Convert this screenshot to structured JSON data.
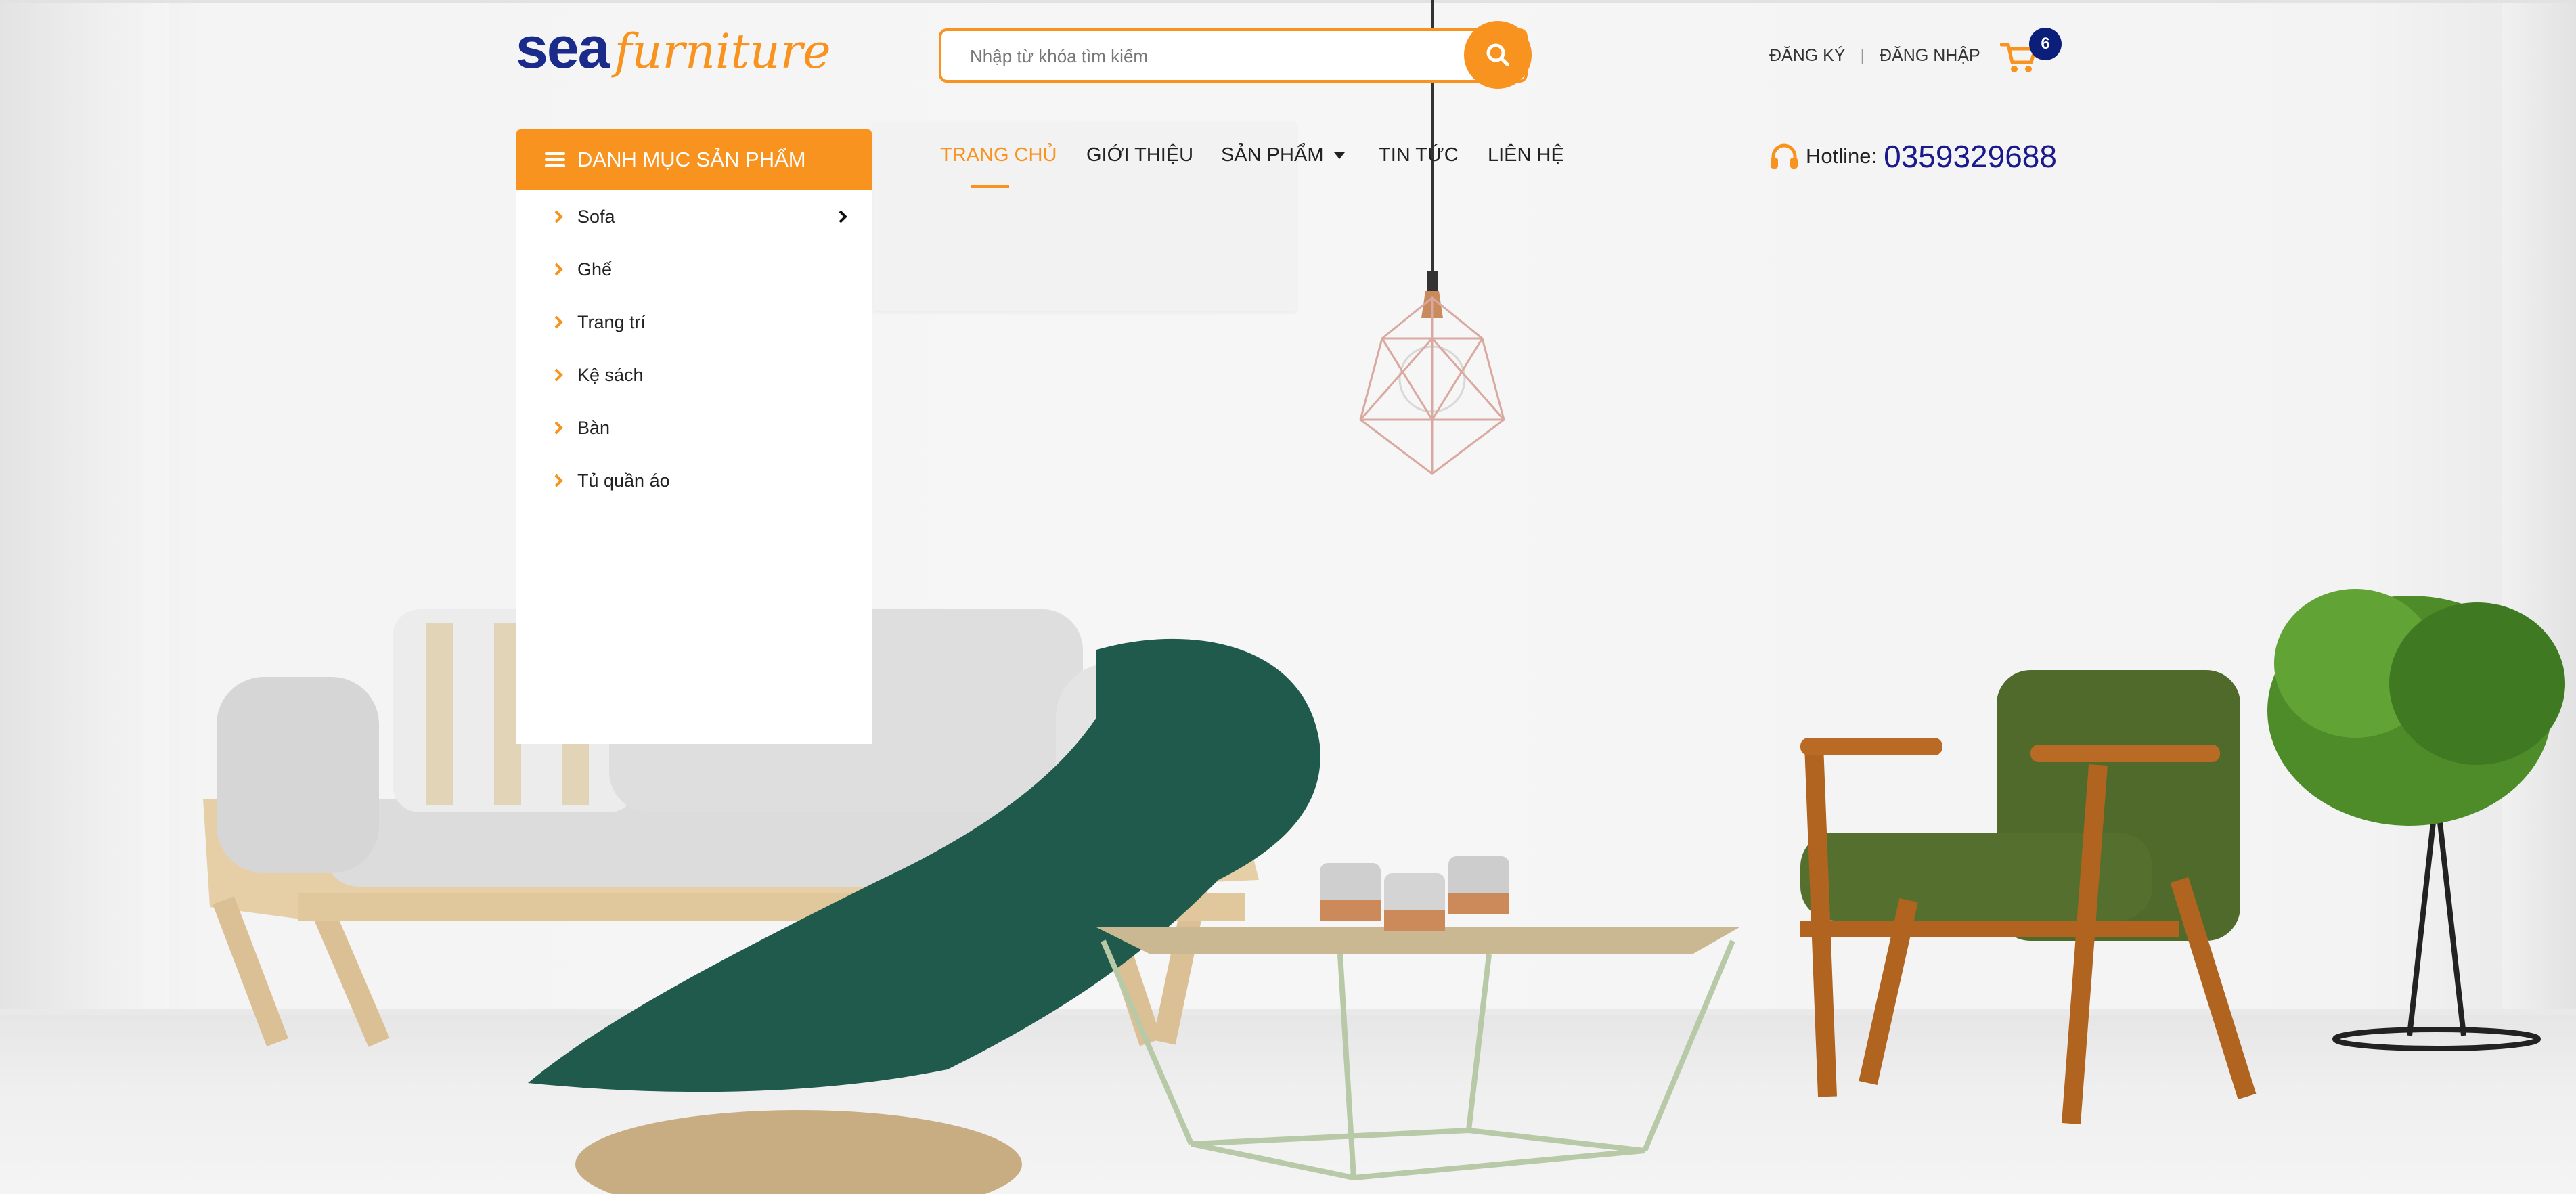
{
  "brand": {
    "logo_primary": "sea",
    "logo_secondary": "furniture",
    "primary_color": "#f7931e",
    "dark_color": "#1a2b8c"
  },
  "search": {
    "placeholder": "Nhập từ khóa tìm kiếm",
    "button_icon": "search-icon"
  },
  "auth": {
    "register": "ĐĂNG KÝ",
    "separator": "|",
    "login": "ĐĂNG NHẬP"
  },
  "cart": {
    "icon": "cart-icon",
    "count": "6"
  },
  "category_menu": {
    "title": "DANH MỤC SẢN PHẨM",
    "items": [
      {
        "label": "Sofa",
        "has_submenu": true
      },
      {
        "label": "Ghế",
        "has_submenu": false
      },
      {
        "label": "Trang trí",
        "has_submenu": false
      },
      {
        "label": "Kệ sách",
        "has_submenu": false
      },
      {
        "label": "Bàn",
        "has_submenu": false
      },
      {
        "label": "Tủ quần áo",
        "has_submenu": false
      }
    ]
  },
  "nav": {
    "home": "TRANG CHỦ",
    "about": "GIỚI THIỆU",
    "products": "SẢN PHẨM",
    "news": "TIN TỨC",
    "contact": "LIÊN HỆ",
    "active": "home"
  },
  "hotline": {
    "label": "Hotline:",
    "number": "0359329688",
    "icon": "headphones-icon"
  }
}
